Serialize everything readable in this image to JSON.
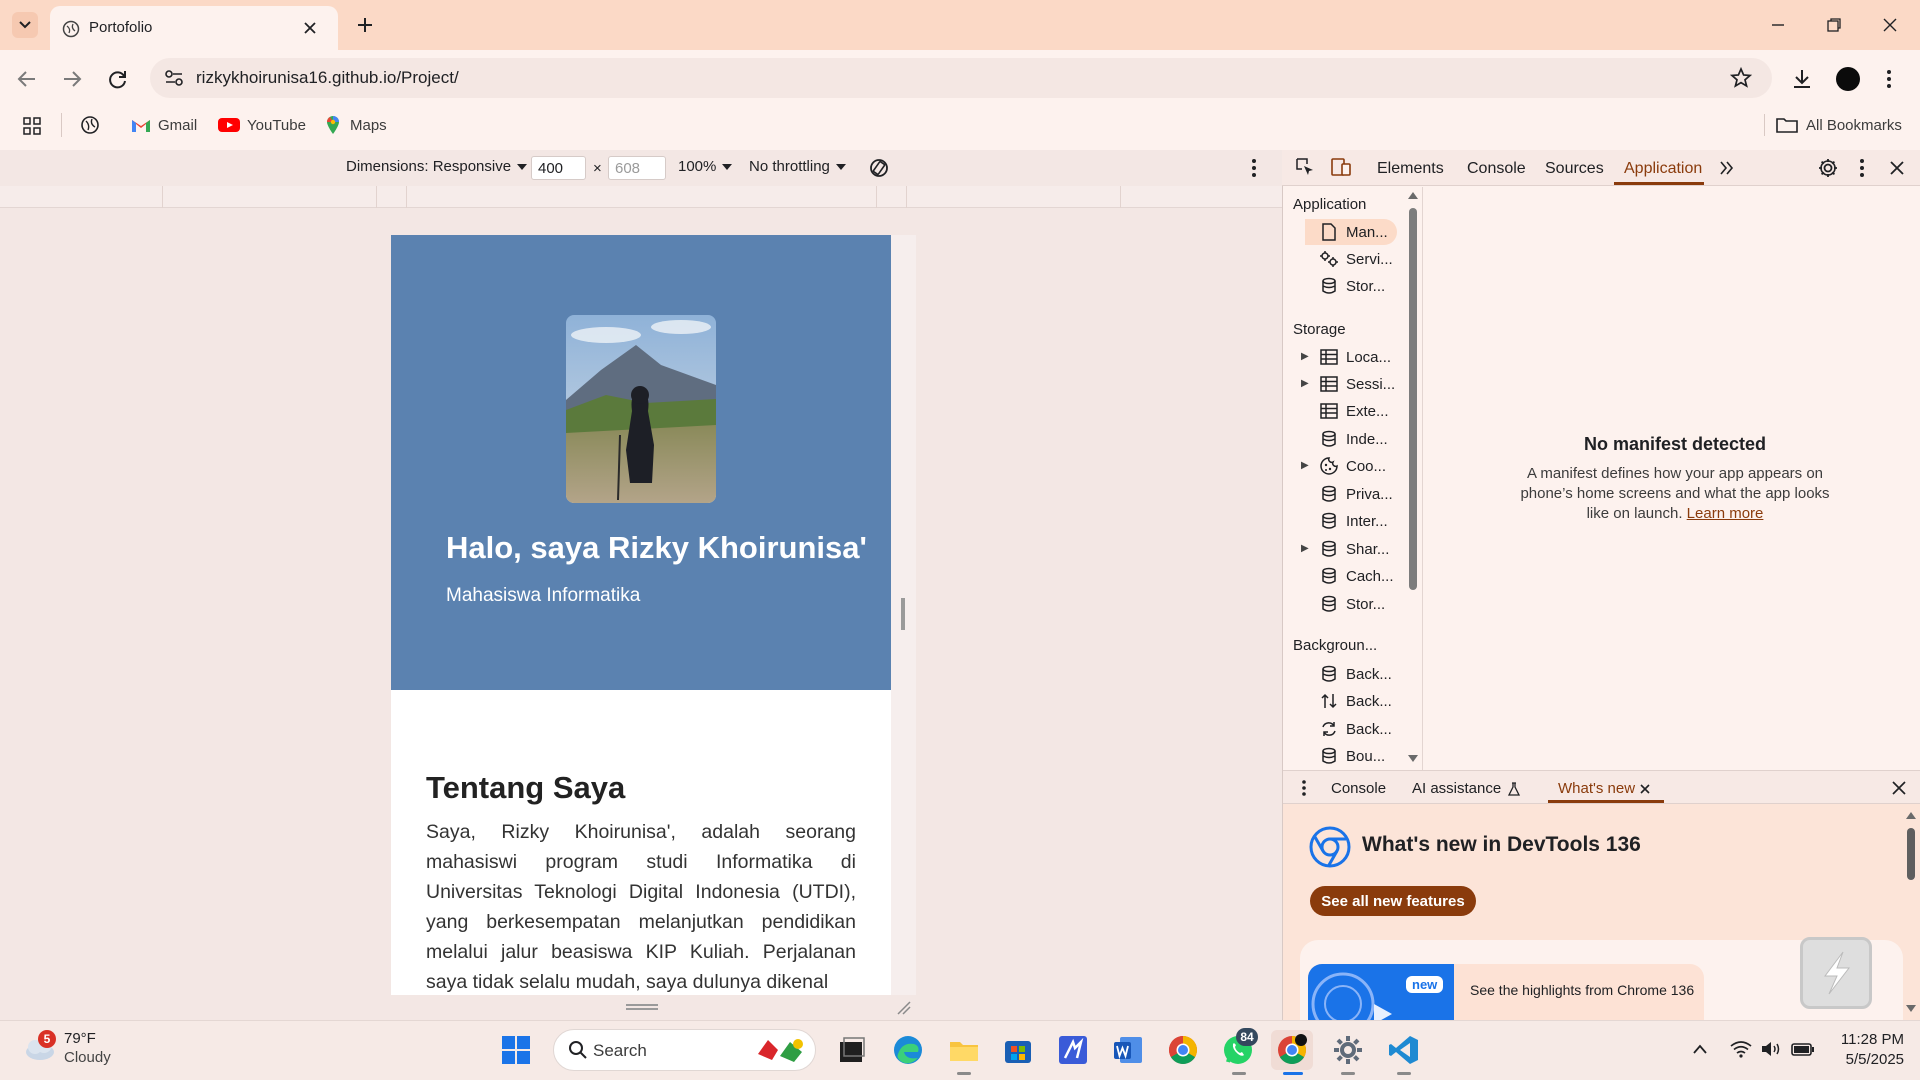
{
  "browser": {
    "tab_title": "Portofolio",
    "url": "rizkykhoirunisa16.github.io/Project/",
    "bookmarks": [
      "Gmail",
      "YouTube",
      "Maps"
    ],
    "all_bookmarks": "All Bookmarks"
  },
  "device_toolbar": {
    "dimensions_label": "Dimensions: Responsive",
    "width": "400",
    "separator": "×",
    "height_placeholder": "608",
    "zoom": "100%",
    "throttling": "No throttling"
  },
  "page": {
    "hero_name": "Halo, saya Rizky Khoirunisa'",
    "hero_subtitle": "Mahasiswa Informatika",
    "about_title": "Tentang Saya",
    "about_text": "Saya, Rizky Khoirunisa', adalah seorang mahasiswi program studi Informatika di Universitas Teknologi Digital Indonesia (UTDI), yang berkesempatan melanjutkan pendidikan melalui jalur beasiswa KIP Kuliah. Perjalanan saya tidak selalu mudah, saya dulunya dikenal"
  },
  "devtools": {
    "tabs": [
      "Elements",
      "Console",
      "Sources",
      "Application"
    ],
    "active_tab": "Application",
    "sidebar": {
      "application_header": "Application",
      "application_items": [
        "Man...",
        "Servi...",
        "Stor..."
      ],
      "storage_header": "Storage",
      "storage_items": [
        "Loca...",
        "Sessi...",
        "Exte...",
        "Inde...",
        "Coo...",
        "Priva...",
        "Inter...",
        "Shar...",
        "Cach...",
        "Stor..."
      ],
      "background_header": "Backgroun...",
      "background_items": [
        "Back...",
        "Back...",
        "Back...",
        "Bou..."
      ]
    },
    "manifest": {
      "title": "No manifest detected",
      "description": "A manifest defines how your app appears on phone’s home screens and what the app looks like on launch.",
      "link": "Learn more"
    },
    "drawer": {
      "tabs": [
        "Console",
        "AI assistance",
        "What's new"
      ],
      "whats_new_title": "What's new in DevTools 136",
      "see_all_button": "See all new features",
      "new_badge": "new",
      "highlights_text": "See the highlights from Chrome 136"
    }
  },
  "taskbar": {
    "weather_temp": "79°F",
    "weather_desc": "Cloudy",
    "weather_badge": "5",
    "search_placeholder": "Search",
    "whatsapp_badge": "84",
    "time": "11:28 PM",
    "date": "5/5/2025"
  },
  "colors": {
    "hero_bg": "#5b82b0",
    "devtools_accent": "#8a3b0c",
    "tabstrip": "#fbd9c6"
  }
}
